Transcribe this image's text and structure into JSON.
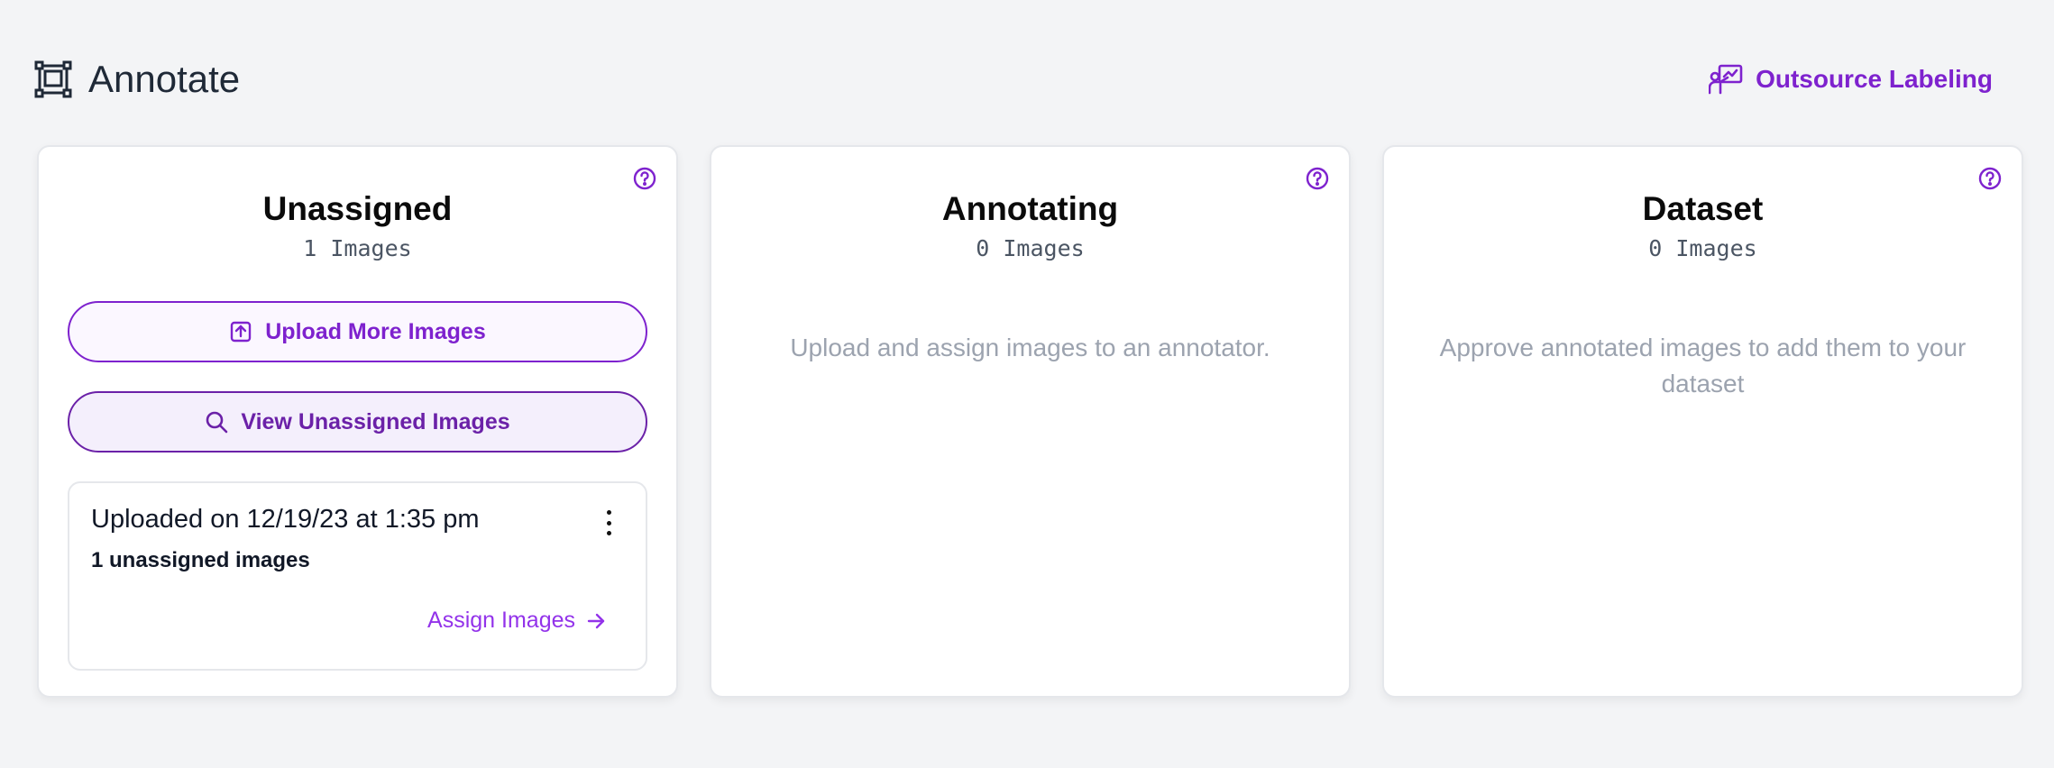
{
  "header": {
    "title": "Annotate",
    "title_icon": "annotate-frame-icon",
    "outsource_label": "Outsource Labeling",
    "outsource_icon": "presentation-chart-icon"
  },
  "colors": {
    "accent": "#7e22ce",
    "background": "#f3f4f6",
    "muted_text": "#9ca3af"
  },
  "columns": [
    {
      "title": "Unassigned",
      "count": "1 Images",
      "help_icon": "question-circle-icon",
      "upload_button": "Upload More Images",
      "upload_icon": "upload-icon",
      "view_button": "View Unassigned Images",
      "view_icon": "search-icon",
      "batch": {
        "title": "Uploaded on 12/19/23 at 1:35 pm",
        "subtitle": "1 unassigned images",
        "action": "Assign Images",
        "menu_icon": "more-vertical-icon",
        "action_icon": "arrow-right-icon"
      }
    },
    {
      "title": "Annotating",
      "count": "0 Images",
      "help_icon": "question-circle-icon",
      "empty_text": "Upload and assign images to an annotator."
    },
    {
      "title": "Dataset",
      "count": "0 Images",
      "help_icon": "question-circle-icon",
      "empty_text": "Approve annotated images to add them to your dataset"
    }
  ]
}
